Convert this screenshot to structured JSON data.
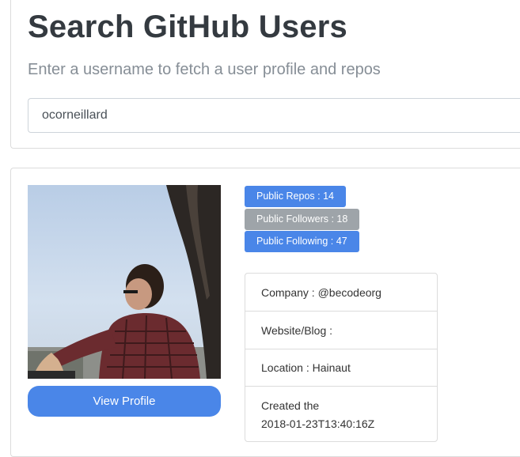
{
  "header": {
    "title": "Search GitHub Users",
    "subtitle": "Enter a username to fetch a user profile and repos"
  },
  "search": {
    "value": "ocorneillard",
    "placeholder": ""
  },
  "profile": {
    "view_profile_label": "View Profile",
    "badges": {
      "repos": "Public Repos : 14",
      "followers": "Public Followers : 18",
      "following": "Public Following : 47"
    },
    "info": {
      "company": "Company : @becodeorg",
      "website": "Website/Blog :",
      "location": "Location : Hainaut",
      "created_label": "Created the",
      "created_value": "2018-01-23T13:40:16Z"
    }
  },
  "colors": {
    "primary": "#4a86e8",
    "secondary": "#9ea4a9",
    "title": "#343a40",
    "muted": "#868e96"
  }
}
